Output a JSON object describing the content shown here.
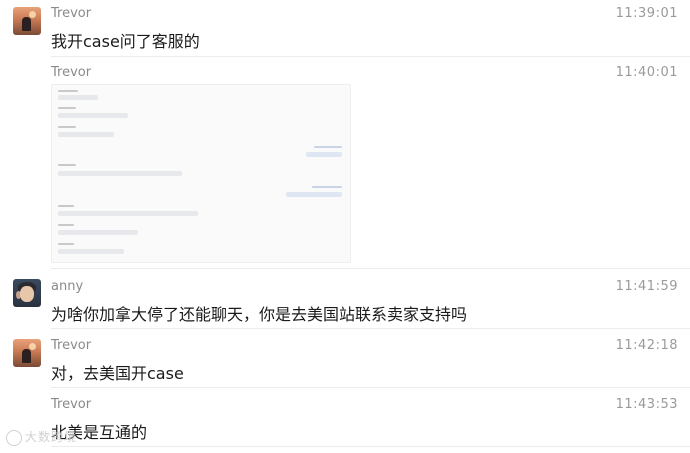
{
  "messages": [
    {
      "sender": "Trevor",
      "time": "11:39:01",
      "text": "我开case问了客服的"
    },
    {
      "sender": "Trevor",
      "time": "11:40:01",
      "attachment": "screenshot-image"
    },
    {
      "sender": "anny",
      "time": "11:41:59",
      "text": "为啥你加拿大停了还能聊天，你是去美国站联系卖家支持吗"
    },
    {
      "sender": "Trevor",
      "time": "11:42:18",
      "text": "对，去美国开case"
    },
    {
      "sender": "Trevor",
      "time": "11:43:53",
      "text": "北美是互通的"
    }
  ],
  "watermark": {
    "text": "大数跨境"
  },
  "icons": {
    "trevor_avatar": "sunset-avatar-icon",
    "anny_avatar": "portrait-avatar-icon",
    "watermark": "logo-icon"
  }
}
